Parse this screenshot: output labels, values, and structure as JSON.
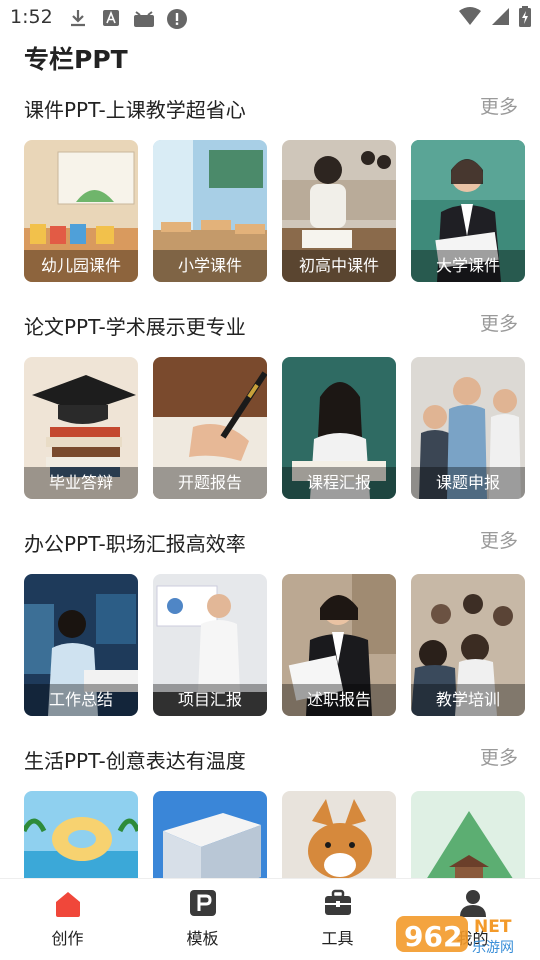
{
  "status_bar": {
    "time": "1:52"
  },
  "page_title": "专栏PPT",
  "more_label": "更多",
  "sections": [
    {
      "title": "课件PPT-上课教学超省心",
      "cards": [
        "幼儿园课件",
        "小学课件",
        "初高中课件",
        "大学课件"
      ]
    },
    {
      "title": "论文PPT-学术展示更专业",
      "cards": [
        "毕业答辩",
        "开题报告",
        "课程汇报",
        "课题申报"
      ]
    },
    {
      "title": "办公PPT-职场汇报高效率",
      "cards": [
        "工作总结",
        "项目汇报",
        "述职报告",
        "教学培训"
      ]
    },
    {
      "title": "生活PPT-创意表达有温度",
      "cards": [
        "",
        "",
        "",
        ""
      ]
    }
  ],
  "bottom_nav": {
    "items": [
      {
        "label": "创作",
        "icon": "home-icon",
        "active": true
      },
      {
        "label": "模板",
        "icon": "template-p-icon",
        "active": false
      },
      {
        "label": "工具",
        "icon": "toolbox-icon",
        "active": false
      },
      {
        "label": "我的",
        "icon": "person-icon",
        "active": false
      }
    ],
    "active_color": "#f0473a"
  },
  "watermark": {
    "text": "962",
    "suffix": "NET",
    "subtitle": "乐游网"
  }
}
